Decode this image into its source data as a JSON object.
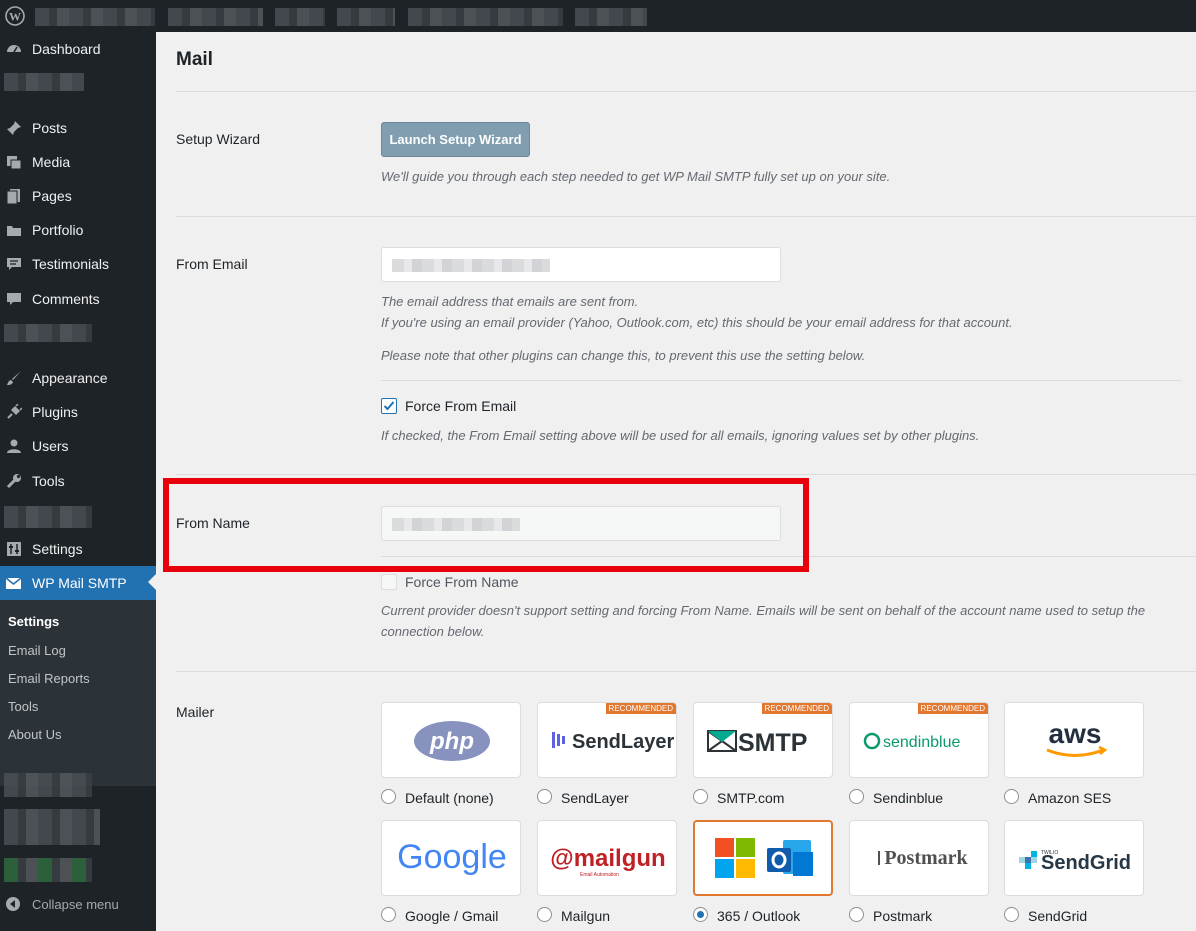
{
  "sidebar": {
    "items": [
      {
        "label": "Dashboard",
        "icon": "dashboard-icon"
      },
      {
        "label": "Posts",
        "icon": "pin-icon"
      },
      {
        "label": "Media",
        "icon": "media-icon"
      },
      {
        "label": "Pages",
        "icon": "pages-icon"
      },
      {
        "label": "Portfolio",
        "icon": "folder-icon"
      },
      {
        "label": "Testimonials",
        "icon": "testimonial-icon"
      },
      {
        "label": "Comments",
        "icon": "comment-icon"
      },
      {
        "label": "Appearance",
        "icon": "brush-icon"
      },
      {
        "label": "Plugins",
        "icon": "plug-icon"
      },
      {
        "label": "Users",
        "icon": "user-icon"
      },
      {
        "label": "Tools",
        "icon": "wrench-icon"
      },
      {
        "label": "Settings",
        "icon": "settings-icon"
      },
      {
        "label": "WP Mail SMTP",
        "icon": "mail-icon"
      }
    ],
    "submenu": [
      "Settings",
      "Email Log",
      "Email Reports",
      "Tools",
      "About Us"
    ],
    "collapse_label": "Collapse menu"
  },
  "page": {
    "title": "Mail",
    "setup_wizard": {
      "label": "Setup Wizard",
      "button": "Launch Setup Wizard",
      "desc": "We'll guide you through each step needed to get WP Mail SMTP fully set up on your site."
    },
    "from_email": {
      "label": "From Email",
      "desc1": "The email address that emails are sent from.",
      "desc2": "If you're using an email provider (Yahoo, Outlook.com, etc) this should be your email address for that account.",
      "desc3": "Please note that other plugins can change this, to prevent this use the setting below.",
      "force_label": "Force From Email",
      "force_checked": true,
      "force_desc": "If checked, the From Email setting above will be used for all emails, ignoring values set by other plugins."
    },
    "from_name": {
      "label": "From Name",
      "force_label": "Force From Name",
      "force_checked": false,
      "desc1": "Current provider doesn't support setting and forcing From Name. Emails will be sent on behalf of the account name used to setup the",
      "desc2": "connection below."
    },
    "mailer": {
      "label": "Mailer",
      "recommended_badge": "RECOMMENDED",
      "options": [
        {
          "label": "Default (none)",
          "logo": "php",
          "recommended": false,
          "selected": false
        },
        {
          "label": "SendLayer",
          "logo": "SendLayer",
          "recommended": true,
          "selected": false
        },
        {
          "label": "SMTP.com",
          "logo": "SMTP",
          "recommended": true,
          "selected": false
        },
        {
          "label": "Sendinblue",
          "logo": "sendinblue",
          "recommended": true,
          "selected": false
        },
        {
          "label": "Amazon SES",
          "logo": "aws",
          "recommended": false,
          "selected": false
        },
        {
          "label": "Google / Gmail",
          "logo": "Google",
          "recommended": false,
          "selected": false
        },
        {
          "label": "Mailgun",
          "logo": "mailgun",
          "logo_sub": "Email Automation",
          "recommended": false,
          "selected": false
        },
        {
          "label": "365 / Outlook",
          "logo": "microsoft-outlook",
          "recommended": false,
          "selected": true
        },
        {
          "label": "Postmark",
          "logo": "Postmark",
          "recommended": false,
          "selected": false
        },
        {
          "label": "SendGrid",
          "logo": "SendGrid",
          "logo_sub": "TWILIO",
          "recommended": false,
          "selected": false
        }
      ]
    }
  },
  "colors": {
    "admin_dark": "#1d2327",
    "accent_blue": "#2271b1",
    "highlight_red": "#e8000b",
    "recommended_orange": "#e27730"
  }
}
